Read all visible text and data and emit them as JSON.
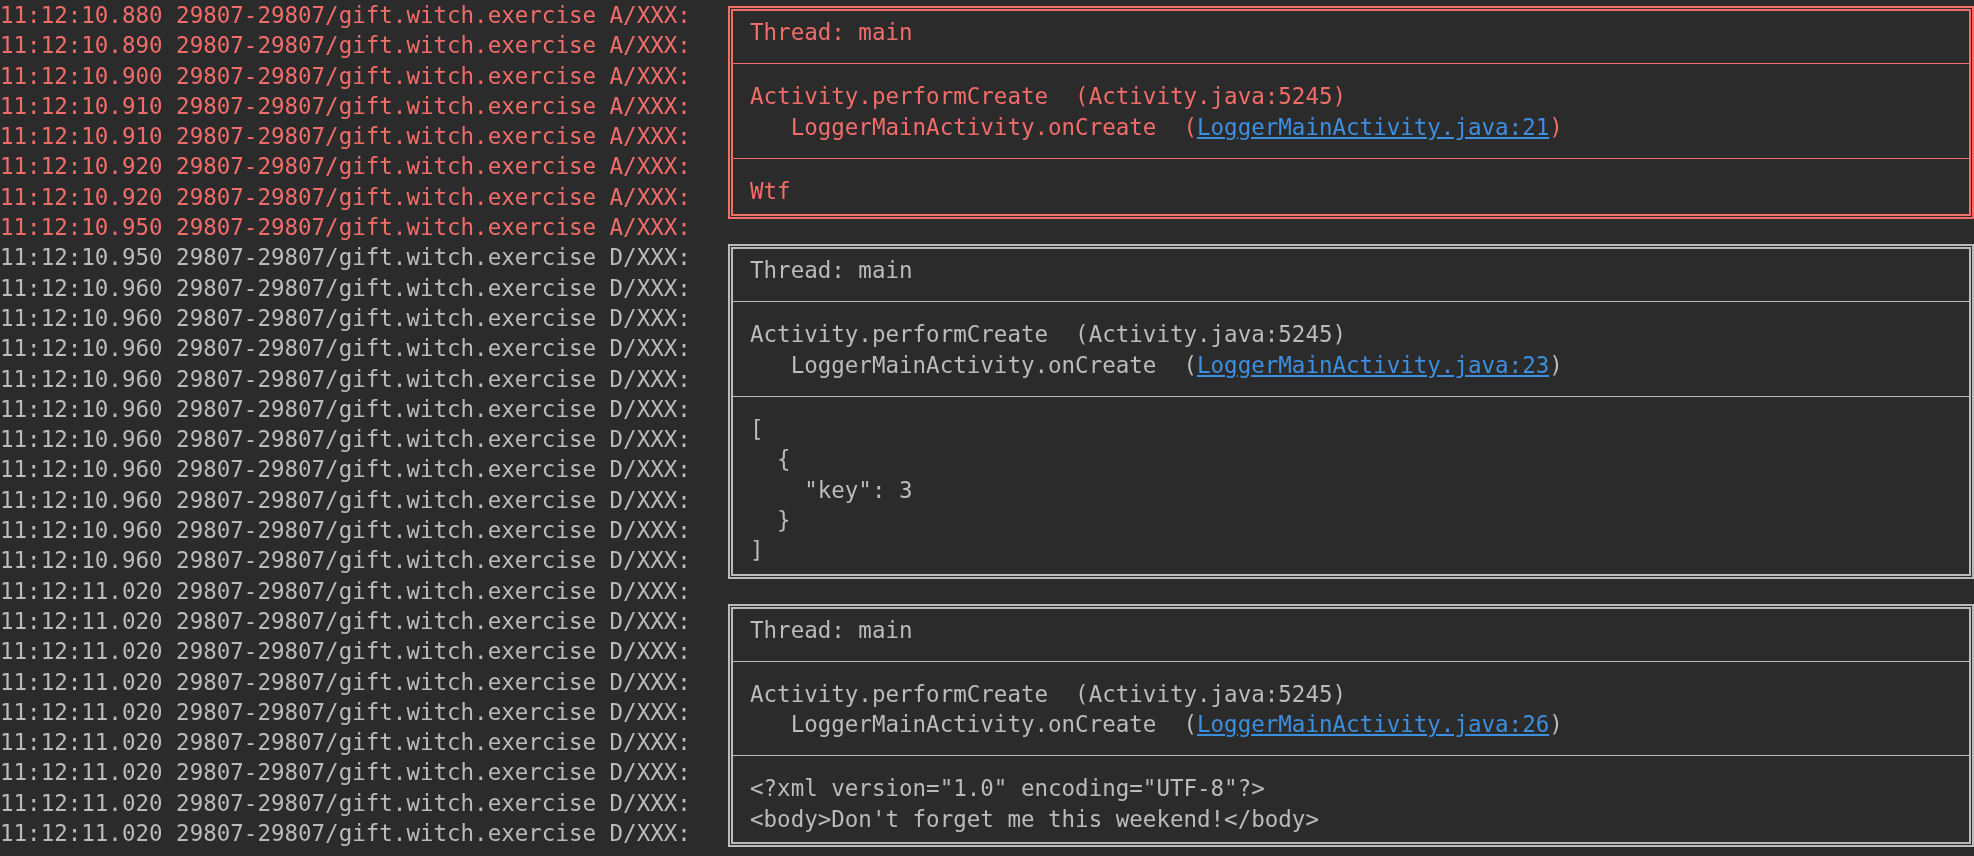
{
  "log_lines": [
    {
      "text": "11:12:10.880 29807-29807/gift.witch.exercise A/XXX:",
      "kind": "assert"
    },
    {
      "text": "11:12:10.890 29807-29807/gift.witch.exercise A/XXX:",
      "kind": "assert"
    },
    {
      "text": "11:12:10.900 29807-29807/gift.witch.exercise A/XXX:",
      "kind": "assert"
    },
    {
      "text": "11:12:10.910 29807-29807/gift.witch.exercise A/XXX:",
      "kind": "assert"
    },
    {
      "text": "11:12:10.910 29807-29807/gift.witch.exercise A/XXX:",
      "kind": "assert"
    },
    {
      "text": "11:12:10.920 29807-29807/gift.witch.exercise A/XXX:",
      "kind": "assert"
    },
    {
      "text": "11:12:10.920 29807-29807/gift.witch.exercise A/XXX:",
      "kind": "assert"
    },
    {
      "text": "11:12:10.950 29807-29807/gift.witch.exercise A/XXX:",
      "kind": "assert"
    },
    {
      "text": "11:12:10.950 29807-29807/gift.witch.exercise D/XXX:",
      "kind": "debug"
    },
    {
      "text": "11:12:10.960 29807-29807/gift.witch.exercise D/XXX:",
      "kind": "debug"
    },
    {
      "text": "11:12:10.960 29807-29807/gift.witch.exercise D/XXX:",
      "kind": "debug"
    },
    {
      "text": "11:12:10.960 29807-29807/gift.witch.exercise D/XXX:",
      "kind": "debug"
    },
    {
      "text": "11:12:10.960 29807-29807/gift.witch.exercise D/XXX:",
      "kind": "debug"
    },
    {
      "text": "11:12:10.960 29807-29807/gift.witch.exercise D/XXX:",
      "kind": "debug"
    },
    {
      "text": "11:12:10.960 29807-29807/gift.witch.exercise D/XXX:",
      "kind": "debug"
    },
    {
      "text": "11:12:10.960 29807-29807/gift.witch.exercise D/XXX:",
      "kind": "debug"
    },
    {
      "text": "11:12:10.960 29807-29807/gift.witch.exercise D/XXX:",
      "kind": "debug"
    },
    {
      "text": "11:12:10.960 29807-29807/gift.witch.exercise D/XXX:",
      "kind": "debug"
    },
    {
      "text": "11:12:10.960 29807-29807/gift.witch.exercise D/XXX:",
      "kind": "debug"
    },
    {
      "text": "11:12:11.020 29807-29807/gift.witch.exercise D/XXX:",
      "kind": "debug"
    },
    {
      "text": "11:12:11.020 29807-29807/gift.witch.exercise D/XXX:",
      "kind": "debug"
    },
    {
      "text": "11:12:11.020 29807-29807/gift.witch.exercise D/XXX:",
      "kind": "debug"
    },
    {
      "text": "11:12:11.020 29807-29807/gift.witch.exercise D/XXX:",
      "kind": "debug"
    },
    {
      "text": "11:12:11.020 29807-29807/gift.witch.exercise D/XXX:",
      "kind": "debug"
    },
    {
      "text": "11:12:11.020 29807-29807/gift.witch.exercise D/XXX:",
      "kind": "debug"
    },
    {
      "text": "11:12:11.020 29807-29807/gift.witch.exercise D/XXX:",
      "kind": "debug"
    },
    {
      "text": "11:12:11.020 29807-29807/gift.witch.exercise D/XXX:",
      "kind": "debug"
    },
    {
      "text": "11:12:11.020 29807-29807/gift.witch.exercise D/XXX:",
      "kind": "debug"
    }
  ],
  "log_boxes": [
    {
      "kind": "assert",
      "thread": "Thread: main",
      "trace": [
        {
          "text": "Activity.performCreate  (Activity.java:5245)"
        },
        {
          "text": "   LoggerMainActivity.onCreate  (",
          "link": "LoggerMainActivity.java:21",
          "suffix": ")"
        }
      ],
      "message": [
        "Wtf"
      ]
    },
    {
      "kind": "debug",
      "thread": "Thread: main",
      "trace": [
        {
          "text": "Activity.performCreate  (Activity.java:5245)"
        },
        {
          "text": "   LoggerMainActivity.onCreate  (",
          "link": "LoggerMainActivity.java:23",
          "suffix": ")"
        }
      ],
      "message": [
        "[",
        "  {",
        "    \"key\": 3",
        "  }",
        "]"
      ]
    },
    {
      "kind": "debug",
      "thread": "Thread: main",
      "trace": [
        {
          "text": "Activity.performCreate  (Activity.java:5245)"
        },
        {
          "text": "   LoggerMainActivity.onCreate  (",
          "link": "LoggerMainActivity.java:26",
          "suffix": ")"
        }
      ],
      "message": [
        "<?xml version=\"1.0\" encoding=\"UTF-8\"?>",
        "<body>Don't forget me this weekend!</body>"
      ]
    }
  ]
}
